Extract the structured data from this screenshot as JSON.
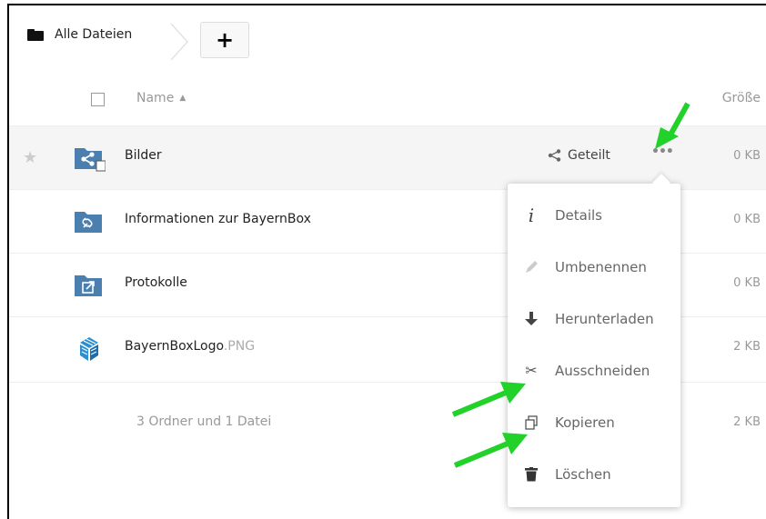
{
  "breadcrumb": {
    "home_label": "Alle Dateien",
    "add_label": "+"
  },
  "header": {
    "name_label": "Name",
    "size_label": "Größe"
  },
  "rows": [
    {
      "name": "Bilder",
      "ext": "",
      "size": "0 KB",
      "icon": "shared-folder-icon",
      "share_label": "Geteilt",
      "more_label": "•••"
    },
    {
      "name": "Informationen zur BayernBox",
      "ext": "",
      "size": "0 KB",
      "icon": "link-folder-icon"
    },
    {
      "name": "Protokolle",
      "ext": "",
      "size": "0 KB",
      "icon": "external-folder-icon"
    },
    {
      "name": "BayernBoxLogo",
      "ext": ".PNG",
      "size": "2 KB",
      "icon": "bayernbox-logo-icon"
    }
  ],
  "summary": {
    "text": "3 Ordner und 1 Datei",
    "size": "2 KB"
  },
  "menu": {
    "items": [
      {
        "label": "Details",
        "icon": "info-icon"
      },
      {
        "label": "Umbenennen",
        "icon": "pencil-icon"
      },
      {
        "label": "Herunterladen",
        "icon": "download-icon"
      },
      {
        "label": "Ausschneiden",
        "icon": "scissors-icon"
      },
      {
        "label": "Kopieren",
        "icon": "copy-icon"
      },
      {
        "label": "Löschen",
        "icon": "trash-icon"
      }
    ]
  },
  "colors": {
    "folder_blue": "#4a7fb0",
    "annotation_green": "#22d12a",
    "accent_dark": "#111111"
  }
}
